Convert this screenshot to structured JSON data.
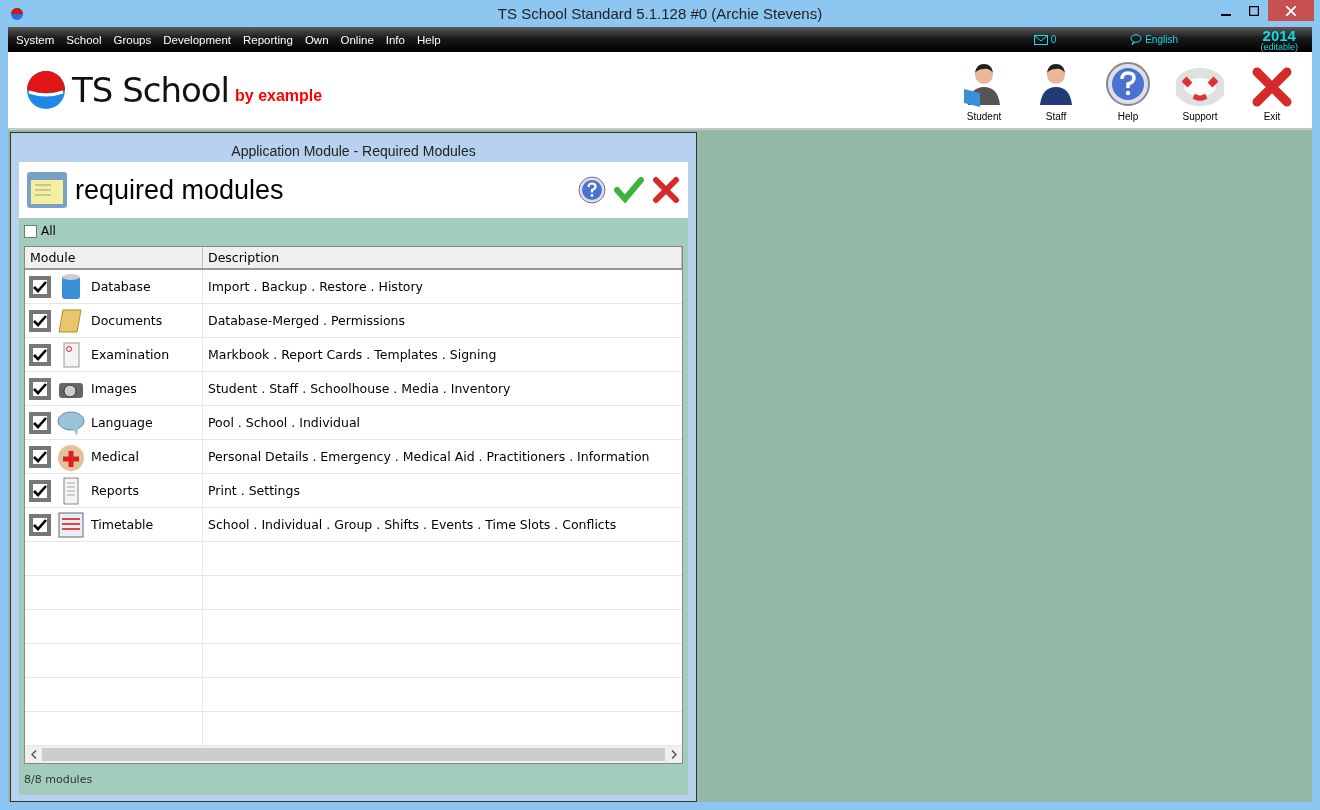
{
  "window": {
    "title": "TS School Standard 5.1.128 #0 (Archie Stevens)"
  },
  "menu": [
    "System",
    "School",
    "Groups",
    "Development",
    "Reporting",
    "Own",
    "Online",
    "Info",
    "Help"
  ],
  "status": {
    "messages": "0",
    "language": "English",
    "year": "2014",
    "year_note": "(editable)"
  },
  "brand": {
    "name": "TS School",
    "tagline": "by example"
  },
  "toolbar": [
    {
      "kind": "student",
      "label": "Student"
    },
    {
      "kind": "staff",
      "label": "Staff"
    },
    {
      "kind": "help",
      "label": "Help"
    },
    {
      "kind": "support",
      "label": "Support"
    },
    {
      "kind": "exit",
      "label": "Exit"
    }
  ],
  "dialog": {
    "title": "Application Module - Required Modules",
    "heading": "required modules",
    "all": {
      "label": "All",
      "checked": false
    },
    "columns": [
      "Module",
      "Description"
    ],
    "rows": [
      {
        "kind": "database",
        "module": "Database",
        "description": "Import . Backup . Restore . History",
        "checked": true
      },
      {
        "kind": "documents",
        "module": "Documents",
        "description": "Database-Merged . Permissions",
        "checked": true
      },
      {
        "kind": "examination",
        "module": "Examination",
        "description": "Markbook . Report Cards . Templates . Signing",
        "checked": true
      },
      {
        "kind": "images",
        "module": "Images",
        "description": "Student . Staff . Schoolhouse . Media . Inventory",
        "checked": true
      },
      {
        "kind": "language",
        "module": "Language",
        "description": "Pool . School . Individual",
        "checked": true
      },
      {
        "kind": "medical",
        "module": "Medical",
        "description": "Personal Details . Emergency . Medical Aid . Practitioners . Information",
        "checked": true
      },
      {
        "kind": "reports",
        "module": "Reports",
        "description": "Print . Settings",
        "checked": true
      },
      {
        "kind": "timetable",
        "module": "Timetable",
        "description": "School . Individual . Group . Shifts . Events . Time Slots . Conflicts",
        "checked": true
      }
    ],
    "footer": "8/8 modules"
  }
}
